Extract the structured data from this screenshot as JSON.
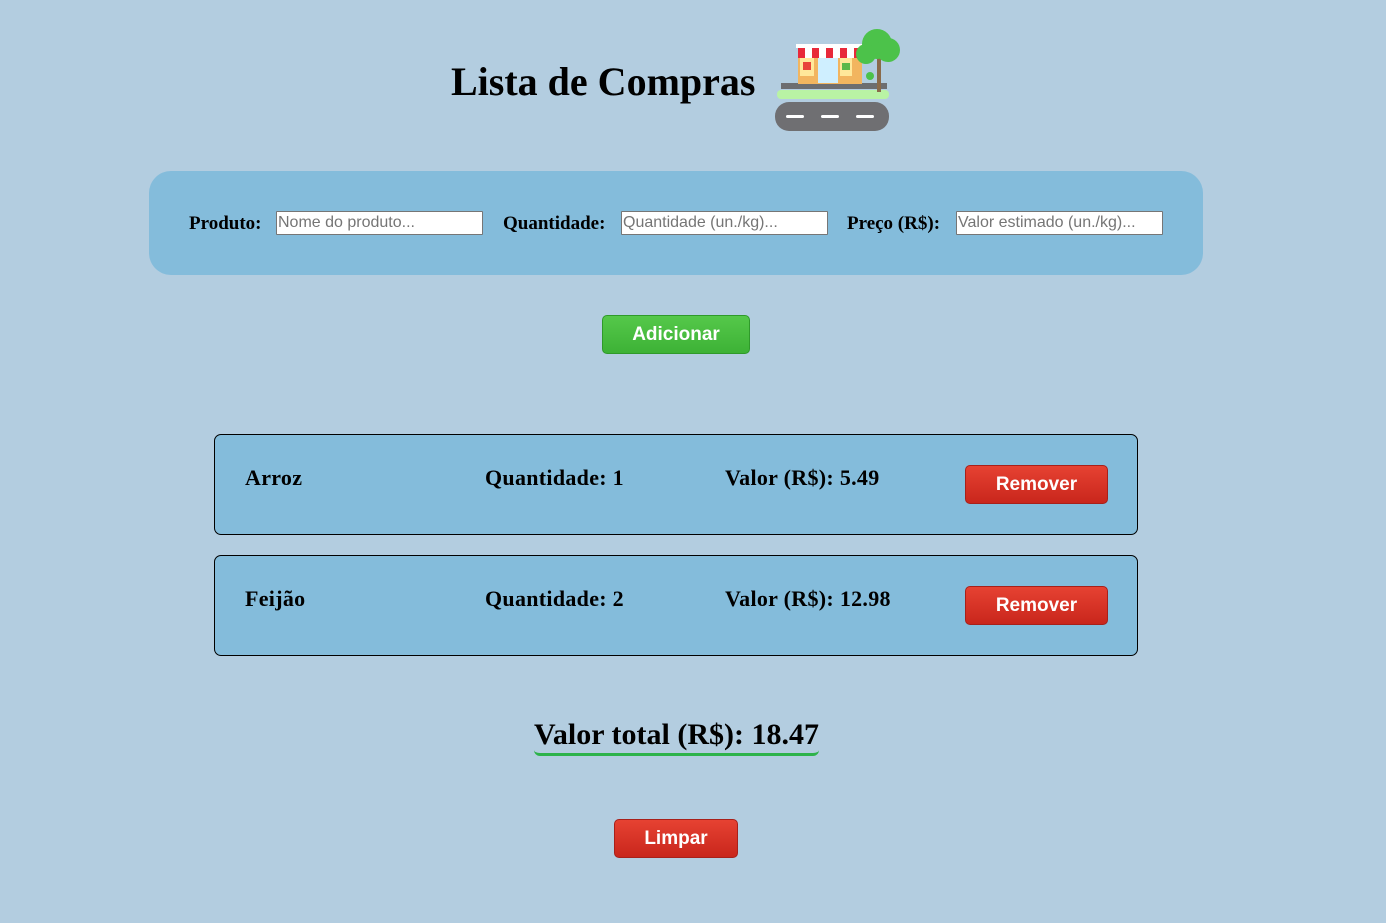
{
  "header": {
    "title": "Lista de Compras"
  },
  "form": {
    "product_label": "Produto:",
    "product_placeholder": "Nome do produto...",
    "quantity_label": "Quantidade:",
    "quantity_placeholder": "Quantidade (un./kg)...",
    "price_label": "Preço (R$):",
    "price_placeholder": "Valor estimado (un./kg)..."
  },
  "add_button_label": "Adicionar",
  "items": [
    {
      "name": "Arroz",
      "quantity": "Quantidade: 1",
      "value": "Valor (R$): 5.49",
      "remove_label": "Remover"
    },
    {
      "name": "Feijão",
      "quantity": "Quantidade: 2",
      "value": "Valor (R$): 12.98",
      "remove_label": "Remover"
    }
  ],
  "total": "Valor total (R$): 18.47",
  "clear_button_label": "Limpar",
  "colors": {
    "background": "#b3cde0",
    "panel": "#84bcdb",
    "add_button": "#4bc043",
    "remove_button": "#d8342a",
    "total_underline": "#2db34a"
  },
  "icons": {
    "header_icon": "store-front-icon"
  }
}
